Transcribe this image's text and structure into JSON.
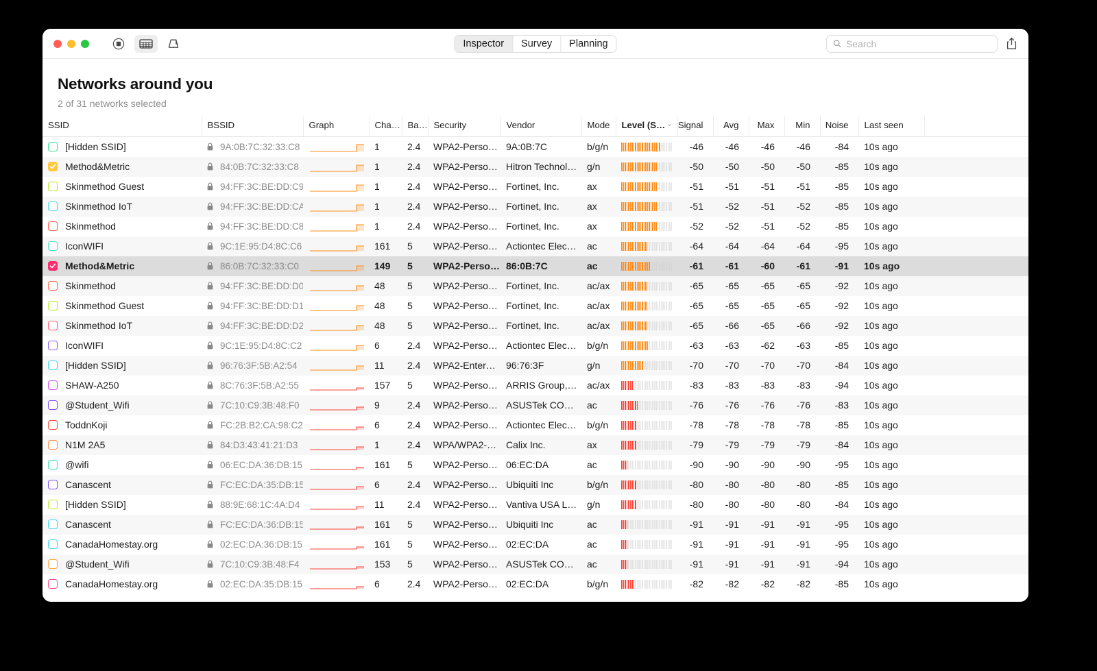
{
  "window": {
    "traffic_lights": [
      "close",
      "minimize",
      "zoom"
    ],
    "toolbar": {
      "record_icon": "record-icon",
      "table_icon": "table-view-icon",
      "map_icon": "map-view-icon",
      "segments": [
        {
          "label": "Inspector",
          "active": true
        },
        {
          "label": "Survey",
          "active": false
        },
        {
          "label": "Planning",
          "active": false
        }
      ],
      "search_placeholder": "Search",
      "search_value": "",
      "share_icon": "share-icon"
    }
  },
  "header": {
    "title": "Networks around you",
    "subtitle": "2 of 31 networks selected"
  },
  "table": {
    "columns": [
      {
        "key": "ssid",
        "label": "SSID",
        "sorted": false
      },
      {
        "key": "bssid",
        "label": "BSSID",
        "sorted": false
      },
      {
        "key": "graph",
        "label": "Graph",
        "sorted": false
      },
      {
        "key": "chan",
        "label": "Cha…",
        "sorted": false
      },
      {
        "key": "band",
        "label": "Ba…",
        "sorted": false
      },
      {
        "key": "security",
        "label": "Security",
        "sorted": false
      },
      {
        "key": "vendor",
        "label": "Vendor",
        "sorted": false
      },
      {
        "key": "mode",
        "label": "Mode",
        "sorted": false
      },
      {
        "key": "level",
        "label": "Level (S…",
        "sorted": true
      },
      {
        "key": "signal",
        "label": "Signal",
        "sorted": false
      },
      {
        "key": "avg",
        "label": "Avg",
        "sorted": false
      },
      {
        "key": "max",
        "label": "Max",
        "sorted": false
      },
      {
        "key": "min",
        "label": "Min",
        "sorted": false
      },
      {
        "key": "noise",
        "label": "Noise",
        "sorted": false
      },
      {
        "key": "last_seen",
        "label": "Last seen",
        "sorted": false
      }
    ],
    "sort_indicator": "chevron-down-icon",
    "rows": [
      {
        "ssid": "[Hidden SSID]",
        "color": "#3ddc97",
        "checked": false,
        "bssid": "9A:0B:7C:32:33:C8",
        "chan": "1",
        "band": "2.4",
        "security": "WPA2-Perso…",
        "vendor": "9A:0B:7C",
        "mode": "b/g/n",
        "level": -46,
        "signal": "-46",
        "avg": "-46",
        "max": "-46",
        "min": "-46",
        "noise": "-84",
        "last_seen": "10s ago",
        "selected": false
      },
      {
        "ssid": "Method&Metric",
        "color": "#ffc83d",
        "checked": true,
        "bssid": "84:0B:7C:32:33:C8",
        "chan": "1",
        "band": "2.4",
        "security": "WPA2-Perso…",
        "vendor": "Hitron Technol…",
        "mode": "g/n",
        "level": -50,
        "signal": "-50",
        "avg": "-50",
        "max": "-50",
        "min": "-50",
        "noise": "-85",
        "last_seen": "10s ago",
        "selected": false
      },
      {
        "ssid": "Skinmethod Guest",
        "color": "#b6e62a",
        "checked": false,
        "bssid": "94:FF:3C:BE:DD:C9",
        "chan": "1",
        "band": "2.4",
        "security": "WPA2-Perso…",
        "vendor": "Fortinet, Inc.",
        "mode": "ax",
        "level": -51,
        "signal": "-51",
        "avg": "-51",
        "max": "-51",
        "min": "-51",
        "noise": "-85",
        "last_seen": "10s ago",
        "selected": false
      },
      {
        "ssid": "Skinmethod IoT",
        "color": "#49d5ef",
        "checked": false,
        "bssid": "94:FF:3C:BE:DD:CA",
        "chan": "1",
        "band": "2.4",
        "security": "WPA2-Perso…",
        "vendor": "Fortinet, Inc.",
        "mode": "ax",
        "level": -51,
        "signal": "-51",
        "avg": "-52",
        "max": "-51",
        "min": "-52",
        "noise": "-85",
        "last_seen": "10s ago",
        "selected": false
      },
      {
        "ssid": "Skinmethod",
        "color": "#ff5b44",
        "checked": false,
        "bssid": "94:FF:3C:BE:DD:C8",
        "chan": "1",
        "band": "2.4",
        "security": "WPA2-Perso…",
        "vendor": "Fortinet, Inc.",
        "mode": "ax",
        "level": -52,
        "signal": "-52",
        "avg": "-52",
        "max": "-51",
        "min": "-52",
        "noise": "-85",
        "last_seen": "10s ago",
        "selected": false
      },
      {
        "ssid": "IconWIFI",
        "color": "#4de0c8",
        "checked": false,
        "bssid": "9C:1E:95:D4:8C:C6",
        "chan": "161",
        "band": "5",
        "security": "WPA2-Perso…",
        "vendor": "Actiontec Elec…",
        "mode": "ac",
        "level": -64,
        "signal": "-64",
        "avg": "-64",
        "max": "-64",
        "min": "-64",
        "noise": "-95",
        "last_seen": "10s ago",
        "selected": false
      },
      {
        "ssid": "Method&Metric",
        "color": "#ff2d6f",
        "checked": true,
        "bssid": "86:0B:7C:32:33:C0",
        "chan": "149",
        "band": "5",
        "security": "WPA2-Perso…",
        "vendor": "86:0B:7C",
        "mode": "ac",
        "level": -61,
        "signal": "-61",
        "avg": "-61",
        "max": "-60",
        "min": "-61",
        "noise": "-91",
        "last_seen": "10s ago",
        "selected": true
      },
      {
        "ssid": "Skinmethod",
        "color": "#ff6a4d",
        "checked": false,
        "bssid": "94:FF:3C:BE:DD:D0",
        "chan": "48",
        "band": "5",
        "security": "WPA2-Perso…",
        "vendor": "Fortinet, Inc.",
        "mode": "ac/ax",
        "level": -65,
        "signal": "-65",
        "avg": "-65",
        "max": "-65",
        "min": "-65",
        "noise": "-92",
        "last_seen": "10s ago",
        "selected": false
      },
      {
        "ssid": "Skinmethod Guest",
        "color": "#b6e62a",
        "checked": false,
        "bssid": "94:FF:3C:BE:DD:D1",
        "chan": "48",
        "band": "5",
        "security": "WPA2-Perso…",
        "vendor": "Fortinet, Inc.",
        "mode": "ac/ax",
        "level": -65,
        "signal": "-65",
        "avg": "-65",
        "max": "-65",
        "min": "-65",
        "noise": "-92",
        "last_seen": "10s ago",
        "selected": false
      },
      {
        "ssid": "Skinmethod IoT",
        "color": "#ff5b72",
        "checked": false,
        "bssid": "94:FF:3C:BE:DD:D2",
        "chan": "48",
        "band": "5",
        "security": "WPA2-Perso…",
        "vendor": "Fortinet, Inc.",
        "mode": "ac/ax",
        "level": -65,
        "signal": "-65",
        "avg": "-66",
        "max": "-65",
        "min": "-66",
        "noise": "-92",
        "last_seen": "10s ago",
        "selected": false
      },
      {
        "ssid": "IconWIFI",
        "color": "#8b5cf6",
        "checked": false,
        "bssid": "9C:1E:95:D4:8C:C2",
        "chan": "6",
        "band": "2.4",
        "security": "WPA2-Perso…",
        "vendor": "Actiontec Elec…",
        "mode": "b/g/n",
        "level": -63,
        "signal": "-63",
        "avg": "-63",
        "max": "-62",
        "min": "-63",
        "noise": "-85",
        "last_seen": "10s ago",
        "selected": false
      },
      {
        "ssid": "[Hidden SSID]",
        "color": "#3ad5f5",
        "checked": false,
        "bssid": "96:76:3F:5B:A2:54",
        "chan": "11",
        "band": "2.4",
        "security": "WPA2-Enter…",
        "vendor": "96:76:3F",
        "mode": "g/n",
        "level": -70,
        "signal": "-70",
        "avg": "-70",
        "max": "-70",
        "min": "-70",
        "noise": "-84",
        "last_seen": "10s ago",
        "selected": false
      },
      {
        "ssid": "SHAW-A250",
        "color": "#d14cf0",
        "checked": false,
        "bssid": "8C:76:3F:5B:A2:55",
        "chan": "157",
        "band": "5",
        "security": "WPA2-Perso…",
        "vendor": "ARRIS Group,…",
        "mode": "ac/ax",
        "level": -83,
        "signal": "-83",
        "avg": "-83",
        "max": "-83",
        "min": "-83",
        "noise": "-94",
        "last_seen": "10s ago",
        "selected": false
      },
      {
        "ssid": "@Student_Wifi",
        "color": "#7c4dff",
        "checked": false,
        "bssid": "7C:10:C9:3B:48:F0",
        "chan": "9",
        "band": "2.4",
        "security": "WPA2-Perso…",
        "vendor": "ASUSTek CO…",
        "mode": "ac",
        "level": -76,
        "signal": "-76",
        "avg": "-76",
        "max": "-76",
        "min": "-76",
        "noise": "-83",
        "last_seen": "10s ago",
        "selected": false
      },
      {
        "ssid": "ToddnKoji",
        "color": "#ff4b36",
        "checked": false,
        "bssid": "FC:2B:B2:CA:98:C2",
        "chan": "6",
        "band": "2.4",
        "security": "WPA2-Perso…",
        "vendor": "Actiontec Elec…",
        "mode": "b/g/n",
        "level": -78,
        "signal": "-78",
        "avg": "-78",
        "max": "-78",
        "min": "-78",
        "noise": "-85",
        "last_seen": "10s ago",
        "selected": false
      },
      {
        "ssid": "N1M 2A5",
        "color": "#ff8c42",
        "checked": false,
        "bssid": "84:D3:43:41:21:D3",
        "chan": "1",
        "band": "2.4",
        "security": "WPA/WPA2-…",
        "vendor": "Calix Inc.",
        "mode": "ax",
        "level": -79,
        "signal": "-79",
        "avg": "-79",
        "max": "-79",
        "min": "-79",
        "noise": "-84",
        "last_seen": "10s ago",
        "selected": false
      },
      {
        "ssid": "@wifi",
        "color": "#3ddfb0",
        "checked": false,
        "bssid": "06:EC:DA:36:DB:15",
        "chan": "161",
        "band": "5",
        "security": "WPA2-Perso…",
        "vendor": "06:EC:DA",
        "mode": "ac",
        "level": -90,
        "signal": "-90",
        "avg": "-90",
        "max": "-90",
        "min": "-90",
        "noise": "-95",
        "last_seen": "10s ago",
        "selected": false
      },
      {
        "ssid": "Canascent",
        "color": "#7c4dff",
        "checked": false,
        "bssid": "FC:EC:DA:35:DB:15",
        "chan": "6",
        "band": "2.4",
        "security": "WPA2-Perso…",
        "vendor": "Ubiquiti Inc",
        "mode": "b/g/n",
        "level": -80,
        "signal": "-80",
        "avg": "-80",
        "max": "-80",
        "min": "-80",
        "noise": "-85",
        "last_seen": "10s ago",
        "selected": false
      },
      {
        "ssid": "[Hidden SSID]",
        "color": "#b6e62a",
        "checked": false,
        "bssid": "88:9E:68:1C:4A:D4",
        "chan": "11",
        "band": "2.4",
        "security": "WPA2-Perso…",
        "vendor": "Vantiva USA L…",
        "mode": "g/n",
        "level": -80,
        "signal": "-80",
        "avg": "-80",
        "max": "-80",
        "min": "-80",
        "noise": "-84",
        "last_seen": "10s ago",
        "selected": false
      },
      {
        "ssid": "Canascent",
        "color": "#3ad5f5",
        "checked": false,
        "bssid": "FC:EC:DA:36:DB:15",
        "chan": "161",
        "band": "5",
        "security": "WPA2-Perso…",
        "vendor": "Ubiquiti Inc",
        "mode": "ac",
        "level": -91,
        "signal": "-91",
        "avg": "-91",
        "max": "-91",
        "min": "-91",
        "noise": "-95",
        "last_seen": "10s ago",
        "selected": false
      },
      {
        "ssid": "CanadaHomestay.org",
        "color": "#3ad5f5",
        "checked": false,
        "bssid": "02:EC:DA:36:DB:15",
        "chan": "161",
        "band": "5",
        "security": "WPA2-Perso…",
        "vendor": "02:EC:DA",
        "mode": "ac",
        "level": -91,
        "signal": "-91",
        "avg": "-91",
        "max": "-91",
        "min": "-91",
        "noise": "-95",
        "last_seen": "10s ago",
        "selected": false
      },
      {
        "ssid": "@Student_Wifi",
        "color": "#ffa53d",
        "checked": false,
        "bssid": "7C:10:C9:3B:48:F4",
        "chan": "153",
        "band": "5",
        "security": "WPA2-Perso…",
        "vendor": "ASUSTek CO…",
        "mode": "ac",
        "level": -91,
        "signal": "-91",
        "avg": "-91",
        "max": "-91",
        "min": "-91",
        "noise": "-94",
        "last_seen": "10s ago",
        "selected": false
      },
      {
        "ssid": "CanadaHomestay.org",
        "color": "#ff4d8d",
        "checked": false,
        "bssid": "02:EC:DA:35:DB:15",
        "chan": "6",
        "band": "2.4",
        "security": "WPA2-Perso…",
        "vendor": "02:EC:DA",
        "mode": "b/g/n",
        "level": -82,
        "signal": "-82",
        "avg": "-82",
        "max": "-82",
        "min": "-82",
        "noise": "-85",
        "last_seen": "10s ago",
        "selected": false
      }
    ]
  },
  "colors": {
    "strong_signal": "#ff8c1a",
    "weak_signal": "#ff4438",
    "bar_empty": "#d2d2d2",
    "selected_row": "#dcdcdc",
    "alt_row": "#f7f7f7"
  }
}
